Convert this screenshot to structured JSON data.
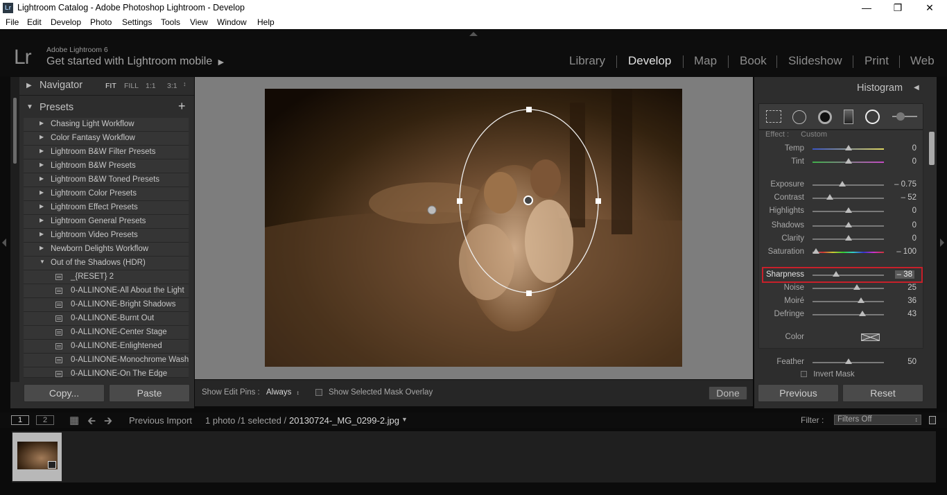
{
  "window": {
    "title": "Lightroom Catalog - Adobe Photoshop Lightroom - Develop",
    "app_badge": "Lr",
    "controls": [
      "minimize",
      "maximize",
      "close"
    ]
  },
  "menu": [
    "File",
    "Edit",
    "Develop",
    "Photo",
    "Settings",
    "Tools",
    "View",
    "Window",
    "Help"
  ],
  "identity": {
    "logo": "Lr",
    "product": "Adobe Lightroom 6",
    "mobile": "Get started with Lightroom mobile"
  },
  "modules": [
    "Library",
    "Develop",
    "Map",
    "Book",
    "Slideshow",
    "Print",
    "Web"
  ],
  "active_module": "Develop",
  "navigator": {
    "title": "Navigator",
    "zoom_options": [
      "FIT",
      "FILL",
      "1:1",
      "3:1"
    ]
  },
  "presets": {
    "title": "Presets",
    "folders": [
      "Chasing Light Workflow",
      "Color Fantasy Workflow",
      "Lightroom B&W Filter Presets",
      "Lightroom B&W Presets",
      "Lightroom B&W Toned Presets",
      "Lightroom Color Presets",
      "Lightroom Effect Presets",
      "Lightroom General Presets",
      "Lightroom Video Presets",
      "Newborn Delights Workflow"
    ],
    "open_folder": "Out of the Shadows (HDR)",
    "items": [
      "_{RESET} 2",
      "0-ALLINONE-All About the Light",
      "0-ALLINONE-Bright Shadows",
      "0-ALLINONE-Burnt Out",
      "0-ALLINONE-Center Stage",
      "0-ALLINONE-Enlightened",
      "0-ALLINONE-Monochrome Wash",
      "0-ALLINONE-On The Edge"
    ]
  },
  "left_buttons": {
    "copy": "Copy...",
    "paste": "Paste"
  },
  "toolbar": {
    "edit_pins_label": "Show Edit Pins :",
    "edit_pins_value": "Always",
    "mask_overlay_label": "Show Selected Mask Overlay",
    "done": "Done"
  },
  "histogram": {
    "title": "Histogram"
  },
  "effect": {
    "label": "Effect :",
    "value": "Custom"
  },
  "sliders": [
    {
      "label": "Temp",
      "value": "0",
      "pos": 0.5
    },
    {
      "label": "Tint",
      "value": "0",
      "pos": 0.5
    },
    {
      "label": "Exposure",
      "value": "– 0.75",
      "pos": 0.42
    },
    {
      "label": "Contrast",
      "value": "– 52",
      "pos": 0.24
    },
    {
      "label": "Highlights",
      "value": "0",
      "pos": 0.5
    },
    {
      "label": "Shadows",
      "value": "0",
      "pos": 0.5
    },
    {
      "label": "Clarity",
      "value": "0",
      "pos": 0.5
    },
    {
      "label": "Saturation",
      "value": "– 100",
      "pos": 0.05
    },
    {
      "label": "Sharpness",
      "value": "– 38",
      "pos": 0.33
    },
    {
      "label": "Noise",
      "value": "25",
      "pos": 0.62
    },
    {
      "label": "Moiré",
      "value": "36",
      "pos": 0.68
    },
    {
      "label": "Defringe",
      "value": "43",
      "pos": 0.7
    }
  ],
  "color_label": "Color",
  "feather": {
    "label": "Feather",
    "value": "50",
    "pos": 0.5
  },
  "invert_mask": "Invert Mask",
  "right_buttons": {
    "previous": "Previous",
    "reset": "Reset"
  },
  "filmstrip": {
    "screen1": "1",
    "screen2": "2",
    "source": "Previous Import",
    "count": "1 photo /1 selected /",
    "filename": "20130724-_MG_0299-2.jpg",
    "filter_label": "Filter :",
    "filter_value": "Filters Off"
  },
  "colors": {
    "background": "#0b0b0b",
    "panel": "#2d2d2d",
    "highlight_border": "#c8202a"
  }
}
